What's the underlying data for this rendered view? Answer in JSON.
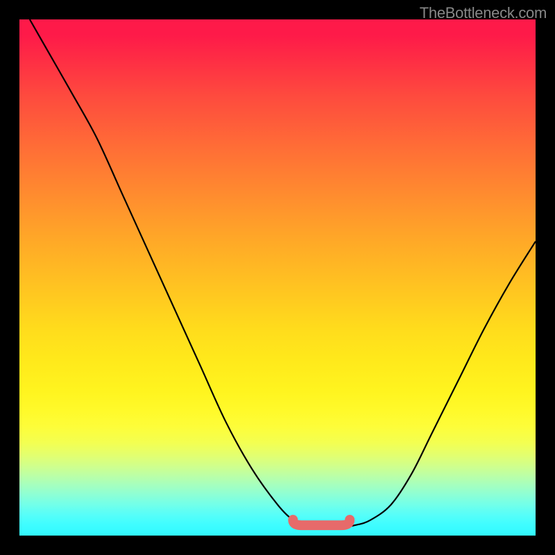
{
  "watermark": "TheBottleneck.com",
  "colors": {
    "background": "#000000",
    "curve": "#000000",
    "marker": "#e76a6a",
    "watermark": "#888888"
  },
  "chart_data": {
    "type": "line",
    "title": "",
    "xlabel": "",
    "ylabel": "",
    "xlim": [
      0,
      100
    ],
    "ylim": [
      0,
      100
    ],
    "grid": false,
    "legend": false,
    "series": [
      {
        "name": "bottleneck-curve",
        "x": [
          2,
          6,
          10,
          15,
          20,
          25,
          30,
          35,
          40,
          45,
          50,
          53,
          55,
          58,
          62,
          65,
          68,
          72,
          76,
          80,
          85,
          90,
          95,
          100
        ],
        "y": [
          100,
          93,
          86,
          77,
          66,
          55,
          44,
          33,
          22,
          13,
          6,
          3,
          2,
          1.5,
          1.5,
          2,
          3,
          6,
          12,
          20,
          30,
          40,
          49,
          57
        ]
      }
    ],
    "marker_segment": {
      "x_start": 53,
      "x_end": 64,
      "y": 2
    }
  }
}
